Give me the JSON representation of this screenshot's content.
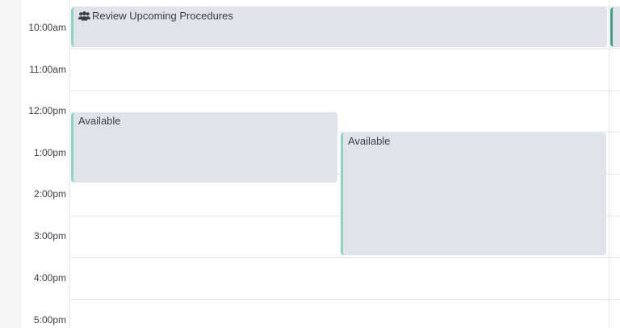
{
  "time_slots": [
    {
      "label": "10:00am"
    },
    {
      "label": "11:00am"
    },
    {
      "label": "12:00pm"
    },
    {
      "label": "1:00pm"
    },
    {
      "label": "2:00pm"
    },
    {
      "label": "3:00pm"
    },
    {
      "label": "4:00pm"
    },
    {
      "label": "5:00pm"
    }
  ],
  "events": {
    "review": {
      "title": "Review Upcoming Procedures",
      "icon": "group-icon"
    },
    "available_1": {
      "title": "Available"
    },
    "available_2": {
      "title": "Available"
    }
  },
  "colors": {
    "event_bg": "#dfe3ea",
    "event_border": "#8fd3c3",
    "cut_event_border": "#3f9f8a",
    "grid_line": "#e3e5e8"
  }
}
